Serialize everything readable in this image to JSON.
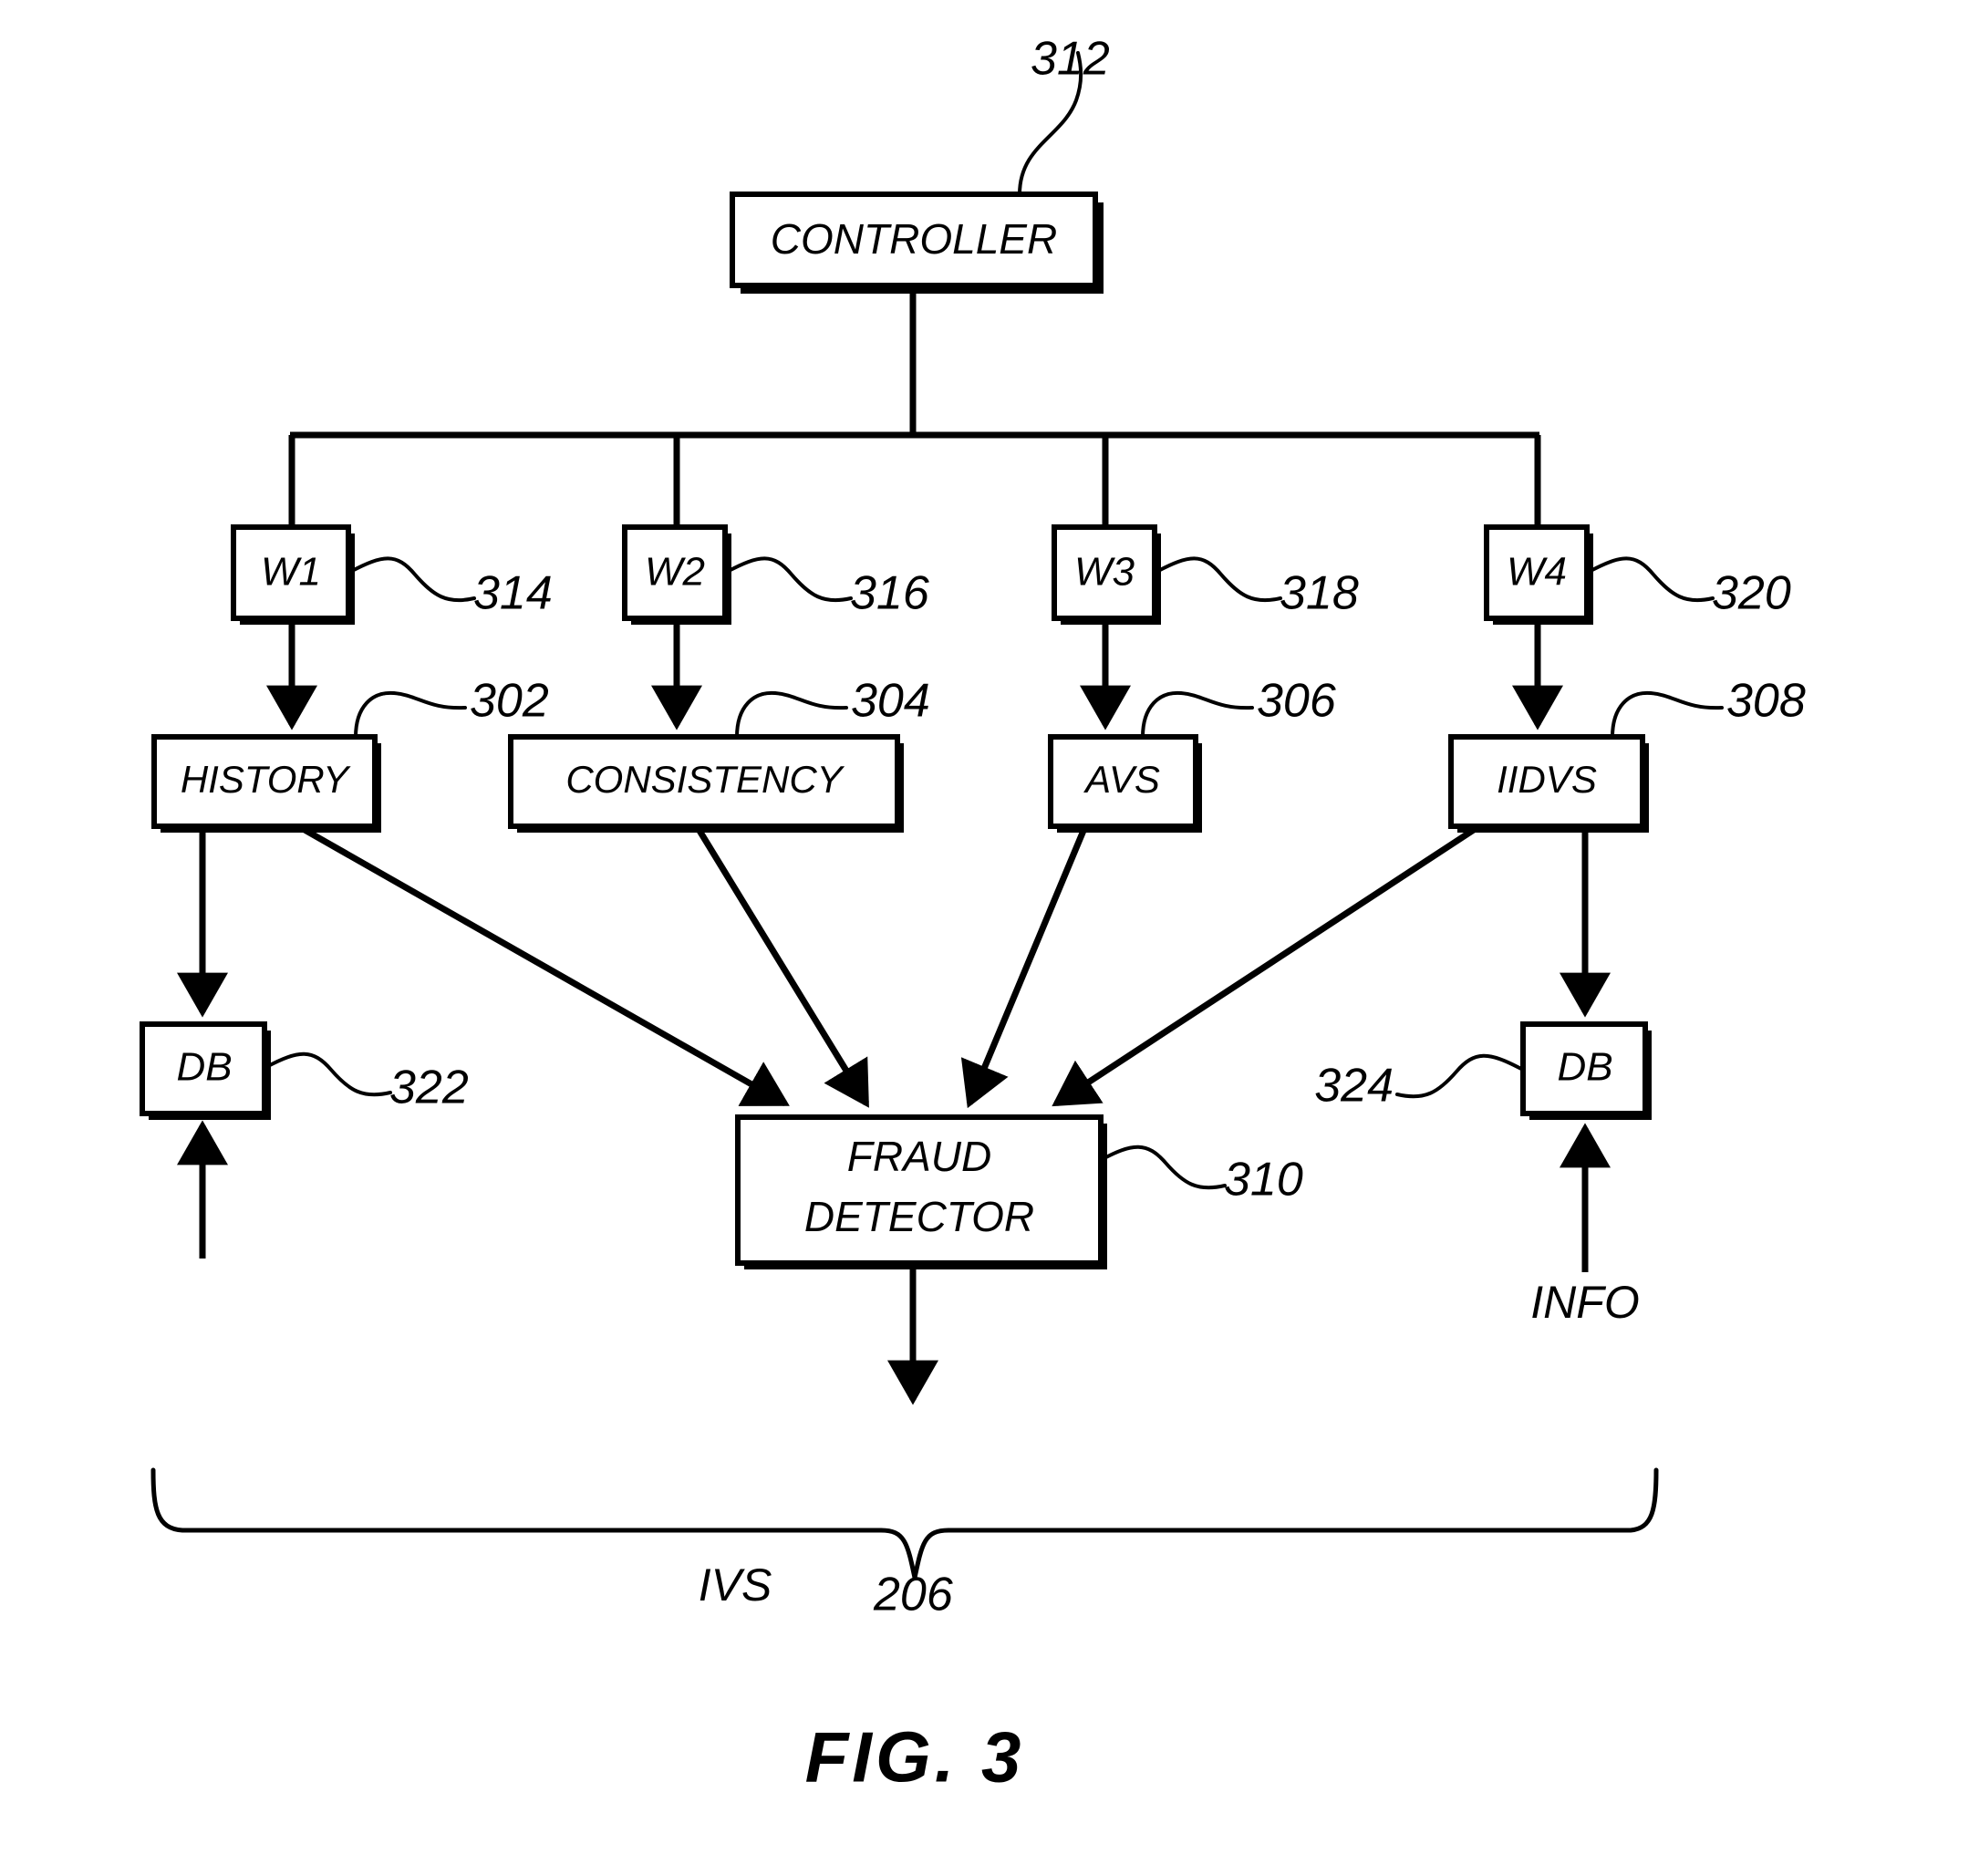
{
  "figure": {
    "caption": "FIG. 3",
    "system_label": "IVS",
    "system_ref": "206"
  },
  "boxes": {
    "controller": {
      "label": "CONTROLLER",
      "ref": "312"
    },
    "w1": {
      "label": "W1",
      "ref": "314"
    },
    "w2": {
      "label": "W2",
      "ref": "316"
    },
    "w3": {
      "label": "W3",
      "ref": "318"
    },
    "w4": {
      "label": "W4",
      "ref": "320"
    },
    "history": {
      "label": "HISTORY",
      "ref": "302"
    },
    "consistency": {
      "label": "CONSISTENCY",
      "ref": "304"
    },
    "avs": {
      "label": "AVS",
      "ref": "306"
    },
    "iidvs": {
      "label": "IIDVS",
      "ref": "308"
    },
    "fraud_detector": {
      "label_line1": "FRAUD",
      "label_line2": "DETECTOR",
      "ref": "310"
    },
    "db_left": {
      "label": "DB",
      "ref": "322"
    },
    "db_right": {
      "label": "DB",
      "ref": "324"
    }
  },
  "labels": {
    "info": "INFO"
  },
  "colors": {
    "ink": "#000000",
    "paper": "#ffffff"
  }
}
